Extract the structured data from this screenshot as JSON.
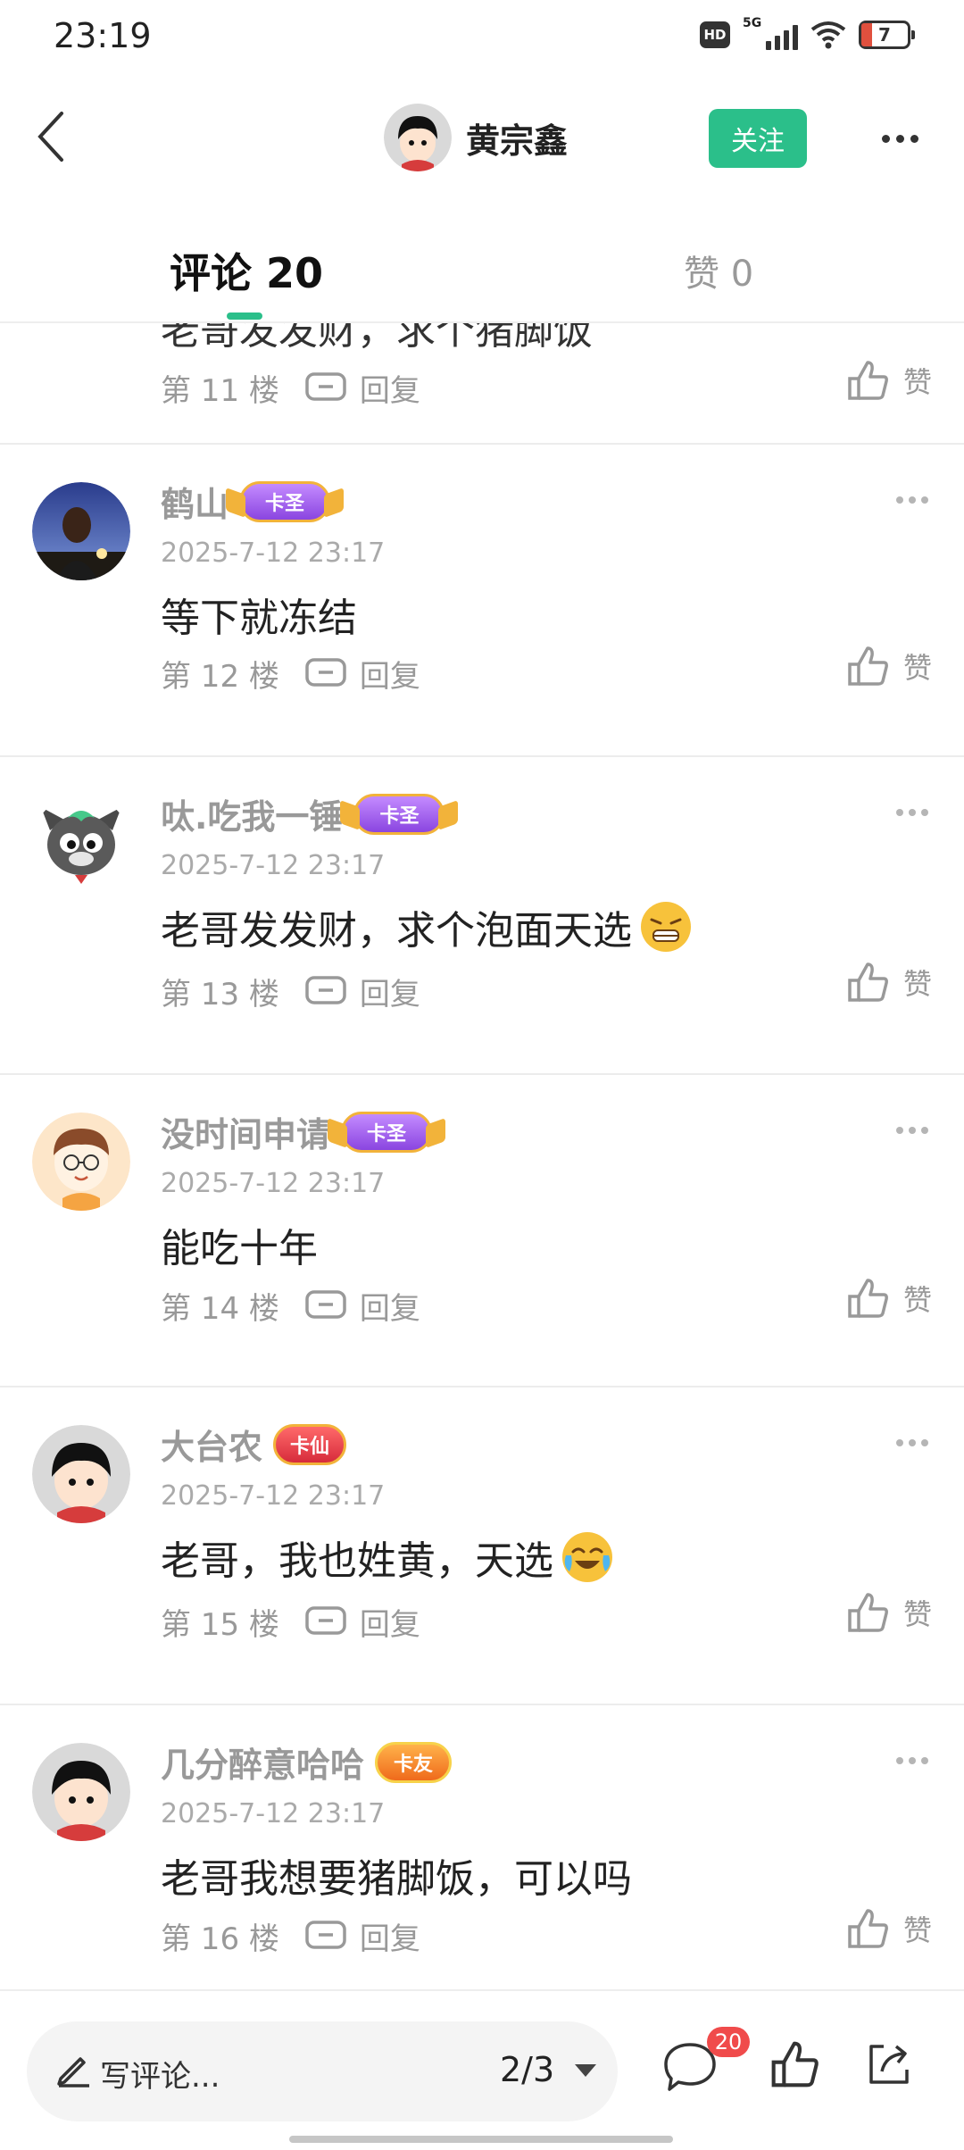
{
  "status_bar": {
    "time": "23:19",
    "hd": "HD",
    "network": "5G",
    "battery": "7"
  },
  "header": {
    "user_name": "黄宗鑫",
    "follow_label": "关注"
  },
  "tabs": {
    "comments_label": "评论 20",
    "likes_label": "赞 0"
  },
  "top_partial": {
    "text": "老哥发发财，求个猪脚饭",
    "floor": "第 11 楼",
    "reply": "回复",
    "like": "赞"
  },
  "comments": [
    {
      "name": "鹤山",
      "badge": "卡圣",
      "time": "2025-7-12 23:17",
      "content": "等下就冻结",
      "floor": "第 12 楼",
      "reply": "回复",
      "like": "赞"
    },
    {
      "name": "呔.吃我一锤",
      "badge": "卡圣",
      "time": "2025-7-12 23:17",
      "content": "老哥发发财，求个泡面天选",
      "floor": "第 13 楼",
      "reply": "回复",
      "like": "赞"
    },
    {
      "name": "没时间申请",
      "badge": "卡圣",
      "time": "2025-7-12 23:17",
      "content": "能吃十年",
      "floor": "第 14 楼",
      "reply": "回复",
      "like": "赞"
    },
    {
      "name": "大台农",
      "badge": "卡仙",
      "time": "2025-7-12 23:17",
      "content": "老哥，我也姓黄，天选",
      "floor": "第 15 楼",
      "reply": "回复",
      "like": "赞"
    },
    {
      "name": "几分醉意哈哈",
      "badge": "卡友",
      "time": "2025-7-12 23:17",
      "content": "老哥我想要猪脚饭，可以吗",
      "floor": "第 16 楼",
      "reply": "回复",
      "like": "赞"
    }
  ],
  "bottom_bar": {
    "write_placeholder": "写评论...",
    "page_indicator": "2/3",
    "comment_count": "20"
  },
  "colors": {
    "accent": "#2bbf8a",
    "badge_red": "#f04b4b",
    "muted": "#999999"
  }
}
